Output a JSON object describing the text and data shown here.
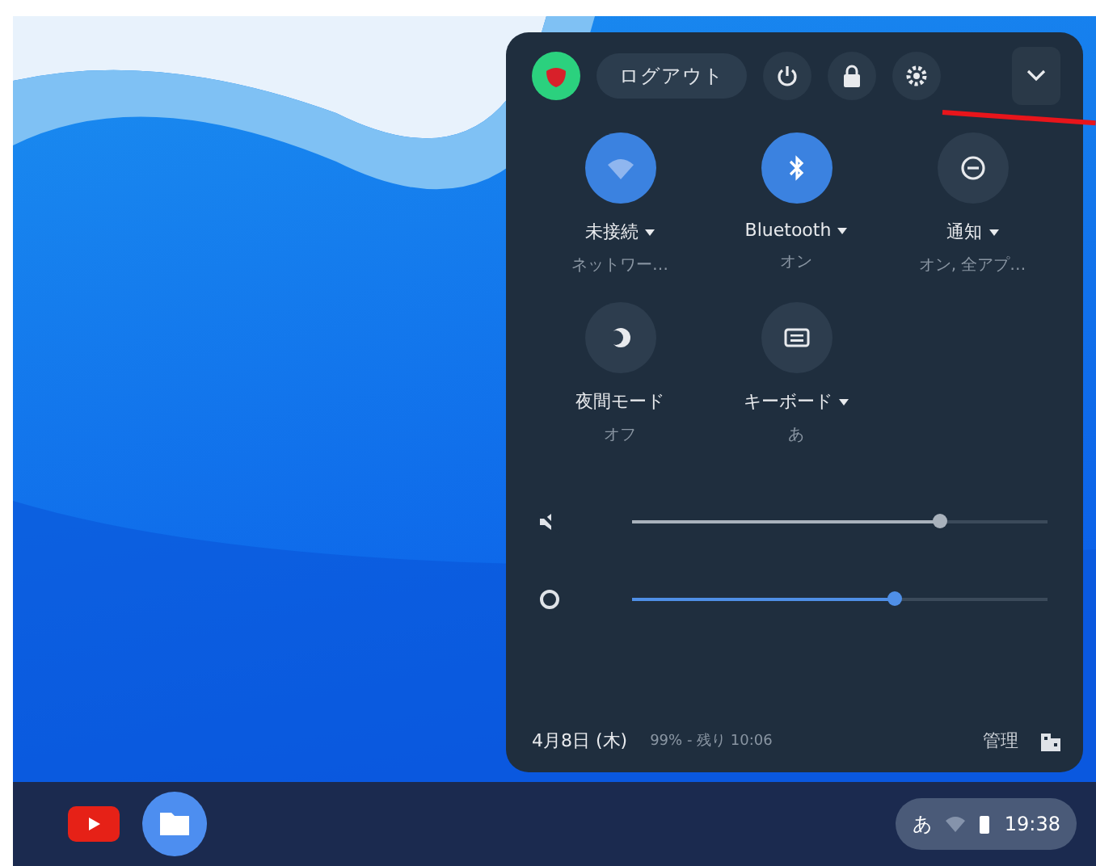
{
  "top_bar": {
    "logout": "ログアウト"
  },
  "pods": [
    {
      "kind": "wifi",
      "label": "未接続",
      "sub": "ネットワー…",
      "on": true,
      "has_menu": true
    },
    {
      "kind": "bluetooth",
      "label": "Bluetooth",
      "sub": "オン",
      "on": true,
      "has_menu": true
    },
    {
      "kind": "notifications",
      "label": "通知",
      "sub": "オン, 全アプ…",
      "on": false,
      "has_menu": true
    },
    {
      "kind": "night",
      "label": "夜間モード",
      "sub": "オフ",
      "on": false,
      "has_menu": false
    },
    {
      "kind": "keyboard",
      "label": "キーボード",
      "sub": "あ",
      "on": false,
      "has_menu": true
    }
  ],
  "sliders": [
    {
      "kind": "volume",
      "muted": true,
      "level": 0.74
    },
    {
      "kind": "brightness",
      "level": 0.63
    }
  ],
  "footer": {
    "date": "4月8日 (木)",
    "battery": "99% - 残り 10:06",
    "managed": "管理"
  },
  "tray": {
    "ime": "あ",
    "time": "19:38"
  }
}
